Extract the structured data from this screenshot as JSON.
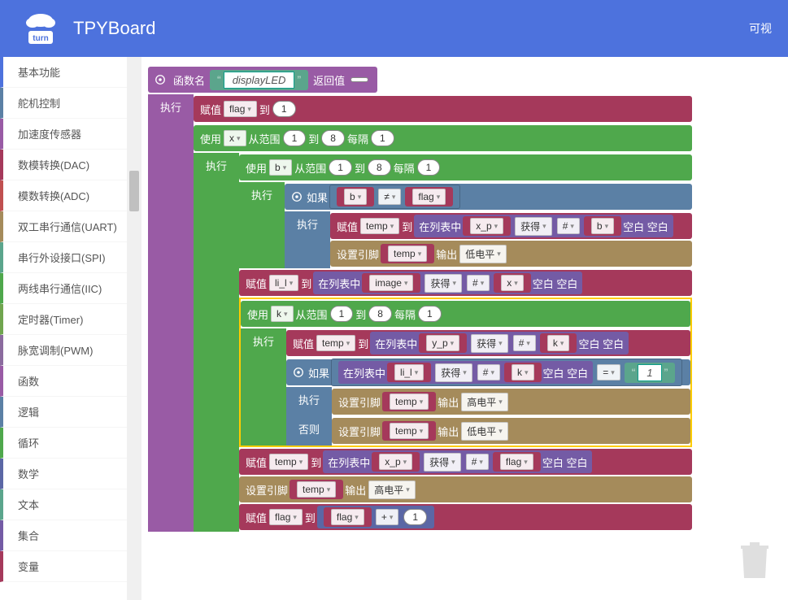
{
  "header": {
    "title": "TPYBoard",
    "right": "可视"
  },
  "sidebar": [
    {
      "label": "基本功能",
      "color": "#4d72dd"
    },
    {
      "label": "舵机控制",
      "color": "#5b80a5"
    },
    {
      "label": "加速度传感器",
      "color": "#995ba5"
    },
    {
      "label": "数模转换(DAC)",
      "color": "#a5395b"
    },
    {
      "label": "模数转换(ADC)",
      "color": "#c05050"
    },
    {
      "label": "双工串行通信(UART)",
      "color": "#a58b5b"
    },
    {
      "label": "串行外设接口(SPI)",
      "color": "#5ba58c"
    },
    {
      "label": "两线串行通信(IIC)",
      "color": "#4fa84c"
    },
    {
      "label": "定时器(Timer)",
      "color": "#70a54f"
    },
    {
      "label": "脉宽调制(PWM)",
      "color": "#8b6b9e"
    },
    {
      "label": "函数",
      "color": "#995ba5"
    },
    {
      "label": "逻辑",
      "color": "#5b80a5"
    },
    {
      "label": "循环",
      "color": "#4fa84c"
    },
    {
      "label": "数学",
      "color": "#5b67a5"
    },
    {
      "label": "文本",
      "color": "#5ba58c"
    },
    {
      "label": "集合",
      "color": "#745ba5"
    },
    {
      "label": "变量",
      "color": "#a5395b"
    }
  ],
  "b": {
    "funcName": "函数名",
    "displayLED": "displayLED",
    "returnVal": "返回值",
    "exec": "执行",
    "assign": "赋值",
    "to": "到",
    "flag": "flag",
    "use": "使用",
    "fromRange": "从范围",
    "every": "每隔",
    "x": "x",
    "b": "b",
    "k": "k",
    "temp": "temp",
    "li_l": "li_l",
    "image": "image",
    "if": "如果",
    "neq": "≠",
    "else": "否则",
    "inList": "在列表中",
    "get": "获得",
    "hash": "#",
    "blank": "空白",
    "x_p": "x_p",
    "y_p": "y_p",
    "setPin": "设置引脚",
    "output": "输出",
    "low": "低电平",
    "high": "高电平",
    "eq": "=",
    "one": "1",
    "plus": "+",
    "n1": "1",
    "n8": "8"
  }
}
